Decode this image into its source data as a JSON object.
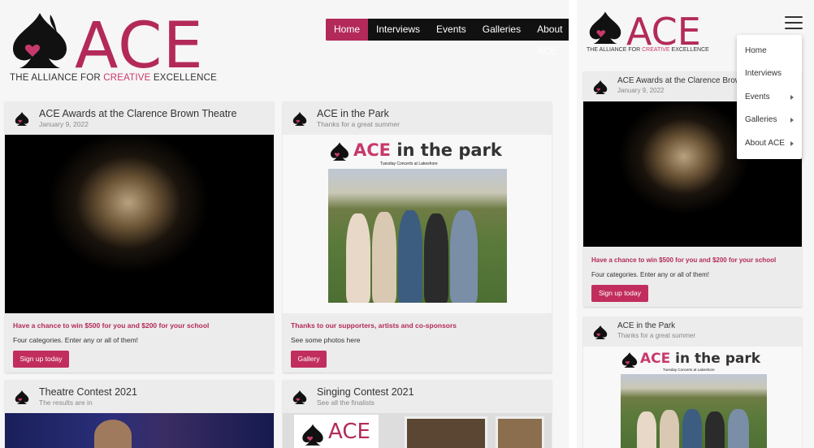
{
  "brand": {
    "name": "ACE",
    "tagline_parts": [
      "THE ALLIANCE FOR ",
      "CREATIVE",
      " EXCELLENCE"
    ],
    "accent_color": "#b32a5a"
  },
  "nav": {
    "items": [
      "Home",
      "Interviews",
      "Events",
      "Galleries",
      "About ACE"
    ],
    "active": "Home"
  },
  "cards": [
    {
      "title": "ACE Awards at the Clarence Brown Theatre",
      "subtitle": "January 9, 2022",
      "promo": "Have a chance to win $500 for you and $200 for your school",
      "description": "Four categories. Enter any or all of them!",
      "button": "Sign up today"
    },
    {
      "title": "ACE in the Park",
      "subtitle": "Thanks for a great summer",
      "graphic_title_pink": "ACE",
      "graphic_title_dark": " in the park",
      "graphic_subtitle": "Tuesday Concerts at Lakeshore",
      "promo": "Thanks to our supporters, artists and co-sponsors",
      "description": "See some photos here",
      "button": "Gallery"
    },
    {
      "title": "Theatre Contest 2021",
      "subtitle": "The results are in"
    },
    {
      "title": "Singing Contest 2021",
      "subtitle": "See all the finalists",
      "strip_logo": "ACE"
    }
  ],
  "mobile": {
    "menu_icon": "hamburger-icon",
    "dropdown": [
      {
        "label": "Home",
        "submenu": false
      },
      {
        "label": "Interviews",
        "submenu": false
      },
      {
        "label": "Events",
        "submenu": true
      },
      {
        "label": "Galleries",
        "submenu": true
      },
      {
        "label": "About ACE",
        "submenu": true
      }
    ],
    "cards": [
      {
        "title": "ACE Awards at the Clarence Brown",
        "subtitle": "January 9, 2022",
        "promo": "Have a chance to win $500 for you and $200 for your school",
        "description": "Four categories. Enter any or all of them!",
        "button": "Sign up today"
      },
      {
        "title": "ACE in the Park",
        "subtitle": "Thanks for a great summer",
        "graphic_title_pink": "ACE",
        "graphic_title_dark": " in the park",
        "graphic_subtitle": "Tuesday Concerts at Lakeshore"
      }
    ]
  }
}
